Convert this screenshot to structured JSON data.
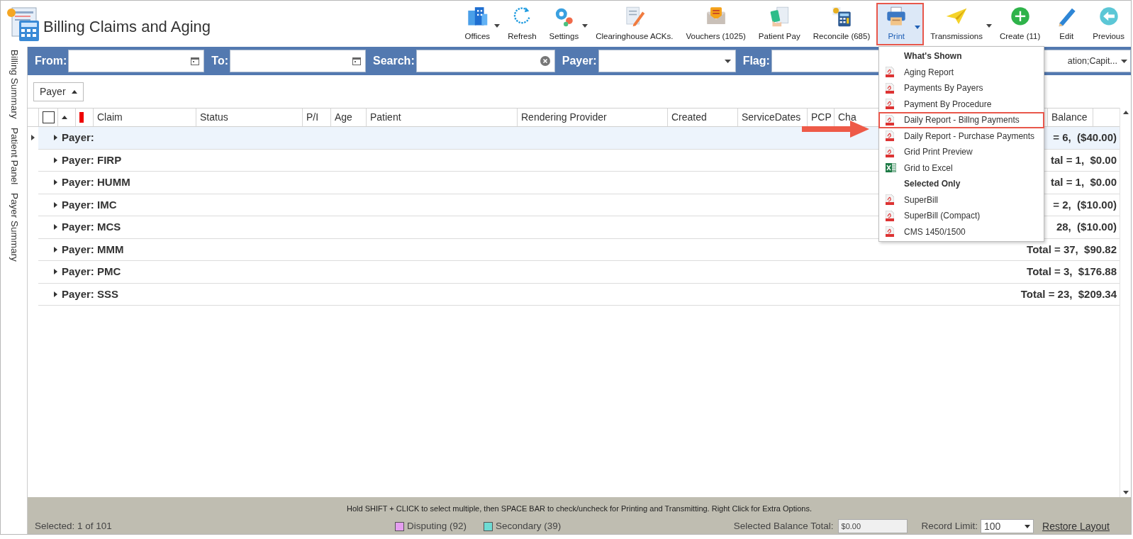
{
  "window": {
    "title": "Billing Claims and Aging"
  },
  "toolbar": [
    {
      "label": "Offices",
      "dropdown": true,
      "pressed": false
    },
    {
      "label": "Refresh",
      "dropdown": false,
      "pressed": false
    },
    {
      "label": "Settings",
      "dropdown": true,
      "pressed": false
    },
    {
      "label": "Clearinghouse ACKs.",
      "dropdown": false,
      "pressed": false
    },
    {
      "label": "Vouchers (1025)",
      "dropdown": false,
      "pressed": false
    },
    {
      "label": "Patient Pay",
      "dropdown": false,
      "pressed": false
    },
    {
      "label": "Reconcile (685)",
      "dropdown": false,
      "pressed": false
    },
    {
      "label": "Print",
      "dropdown": true,
      "pressed": true
    },
    {
      "label": "Transmissions",
      "dropdown": true,
      "pressed": false
    },
    {
      "label": "Create (11)",
      "dropdown": false,
      "pressed": false
    },
    {
      "label": "Edit",
      "dropdown": false,
      "pressed": false
    },
    {
      "label": "Previous",
      "dropdown": false,
      "pressed": false
    }
  ],
  "side_tabs": [
    "Billing Summary",
    "Patient Panel",
    "Payer Summary"
  ],
  "filters": [
    {
      "label": "From:",
      "kind": "date"
    },
    {
      "label": "To:",
      "kind": "date"
    },
    {
      "label": "Search:",
      "kind": "search"
    },
    {
      "label": "Payer:",
      "kind": "select"
    },
    {
      "label": "Flag:",
      "kind": "text"
    },
    {
      "kind": "select",
      "value": "ation;Capit..."
    }
  ],
  "group_by": {
    "label": "Payer"
  },
  "table": {
    "select_all_checked": false,
    "columns": [
      "Claim",
      "Status",
      "P/I",
      "Age",
      "Patient",
      "Rendering Provider",
      "Created",
      "ServiceDates",
      "PCP",
      "Cha",
      "Balance"
    ],
    "rows": [
      {
        "group": "Payer:",
        "total": "= 6,  ($40.00)",
        "selected": true,
        "expanded": false
      },
      {
        "group": "Payer: FIRP",
        "total": "tal = 1,  $0.00",
        "selected": false,
        "expanded": false
      },
      {
        "group": "Payer: HUMM",
        "total": "tal = 1,  $0.00",
        "selected": false,
        "expanded": false
      },
      {
        "group": "Payer: IMC",
        "total": "= 2,  ($10.00)",
        "selected": false,
        "expanded": false
      },
      {
        "group": "Payer: MCS",
        "total": "28,  ($10.00)",
        "selected": false,
        "expanded": false
      },
      {
        "group": "Payer: MMM",
        "total": "Total = 37,  $90.82",
        "selected": false,
        "expanded": false
      },
      {
        "group": "Payer: PMC",
        "total": "Total = 3,  $176.88",
        "selected": false,
        "expanded": false
      },
      {
        "group": "Payer: SSS",
        "total": "Total = 23,  $209.34",
        "selected": false,
        "expanded": false
      }
    ]
  },
  "print_menu": {
    "items": [
      {
        "kind": "header",
        "label": "What's Shown",
        "highlighted": false
      },
      {
        "kind": "pdf",
        "label": "Aging Report",
        "highlighted": false
      },
      {
        "kind": "pdf",
        "label": "Payments By Payers",
        "highlighted": false
      },
      {
        "kind": "pdf",
        "label": "Payment By Procedure",
        "highlighted": false
      },
      {
        "kind": "pdf",
        "label": "Daily Report - Billng Payments",
        "highlighted": true
      },
      {
        "kind": "pdf",
        "label": "Daily Report - Purchase Payments",
        "highlighted": false
      },
      {
        "kind": "pdf",
        "label": "Grid Print Preview",
        "highlighted": false
      },
      {
        "kind": "excel",
        "label": "Grid to Excel",
        "highlighted": false
      },
      {
        "kind": "header",
        "label": "Selected Only",
        "highlighted": false
      },
      {
        "kind": "pdf",
        "label": "SuperBill",
        "highlighted": false
      },
      {
        "kind": "pdf",
        "label": "SuperBill (Compact)",
        "highlighted": false
      },
      {
        "kind": "pdf",
        "label": "CMS 1450/1500",
        "highlighted": false
      }
    ]
  },
  "footer": {
    "hint": "Hold SHIFT + CLICK to select multiple, then SPACE BAR to check/uncheck for Printing and Transmitting. Right Click for Extra Options.",
    "selection": "Selected: 1 of 101",
    "legend": [
      {
        "label": "Disputing (92)",
        "color": "#e59ef0"
      },
      {
        "label": "Secondary (39)",
        "color": "#6edbd3"
      }
    ],
    "balance_label": "Selected Balance Total:",
    "balance_value": "$0.00",
    "record_limit_label": "Record Limit:",
    "record_limit": "100",
    "restore_link": "Restore Layout"
  }
}
